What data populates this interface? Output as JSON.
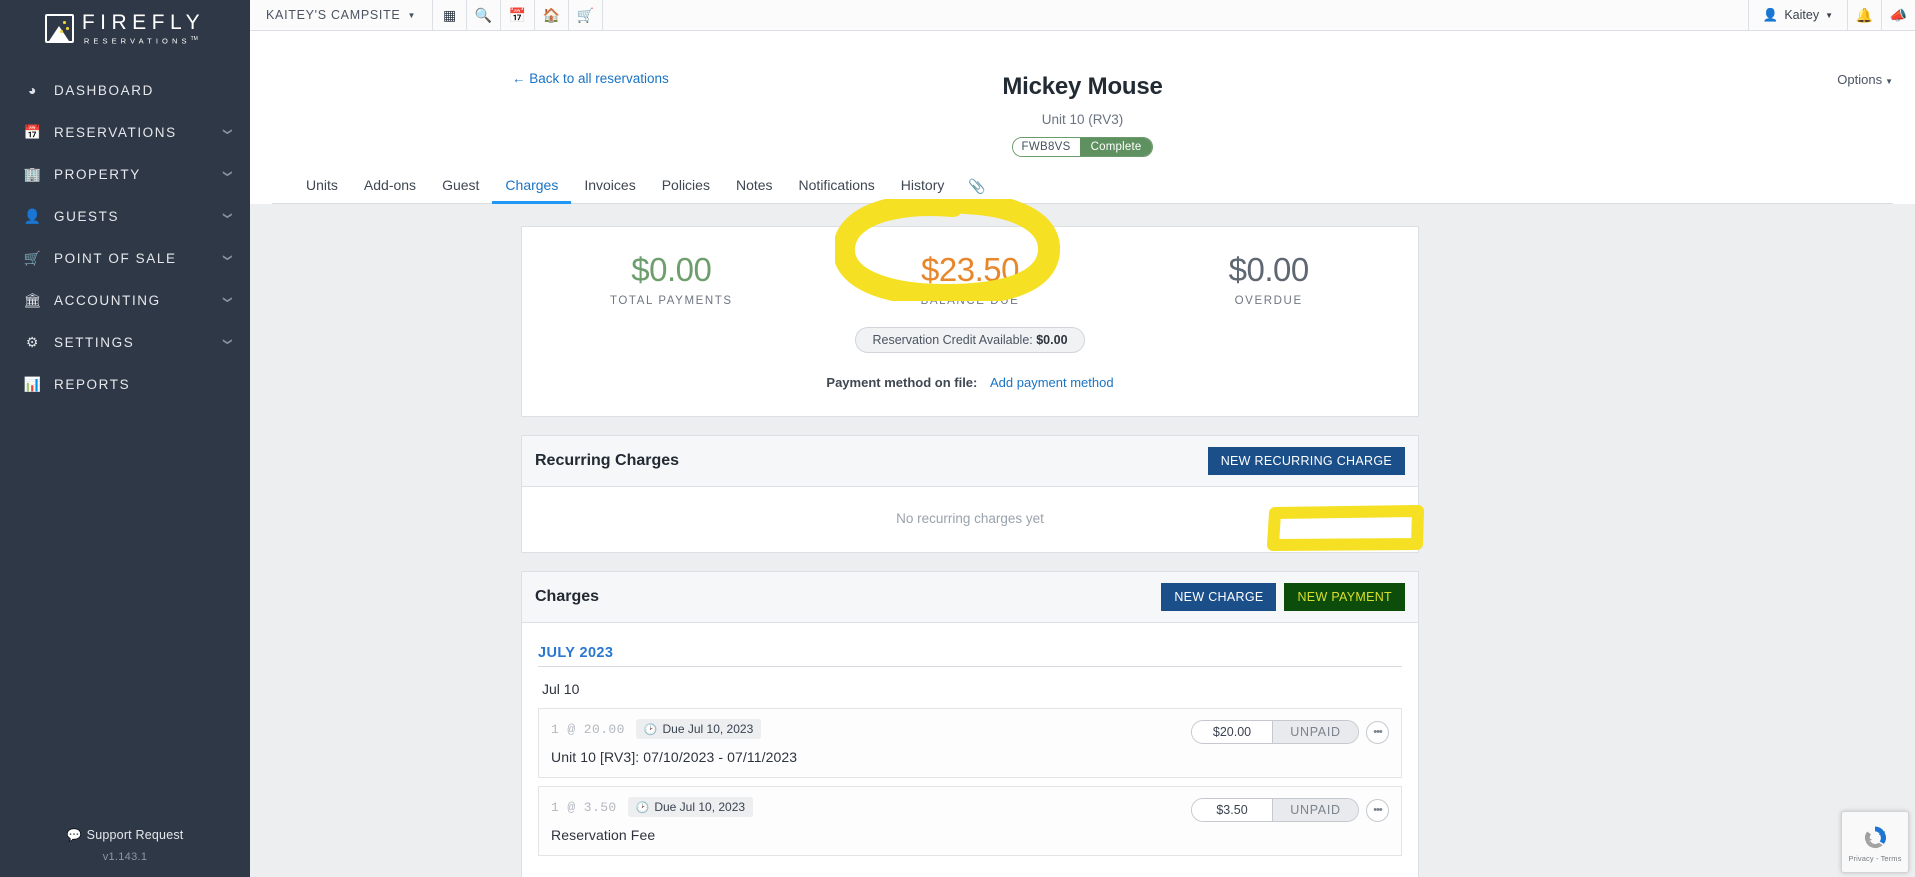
{
  "sidebar": {
    "brand": {
      "name": "FIREFLY",
      "sub": "RESERVATIONS",
      "tm": "TM",
      "logo_icon": "firefly-mountain-logo"
    },
    "items": [
      {
        "label": "DASHBOARD",
        "icon": "dashboard-gauge-icon",
        "caret": ""
      },
      {
        "label": "RESERVATIONS",
        "icon": "calendar-icon",
        "caret": "❯"
      },
      {
        "label": "PROPERTY",
        "icon": "building-icon",
        "caret": "❯"
      },
      {
        "label": "GUESTS",
        "icon": "person-icon",
        "caret": "❯"
      },
      {
        "label": "POINT OF SALE",
        "icon": "cash-register-icon",
        "caret": "❯"
      },
      {
        "label": "ACCOUNTING",
        "icon": "bank-icon",
        "caret": "❯"
      },
      {
        "label": "SETTINGS",
        "icon": "gear-icon",
        "caret": "❯"
      },
      {
        "label": "REPORTS",
        "icon": "bar-chart-icon",
        "caret": ""
      }
    ],
    "support_label": "Support Request",
    "support_icon": "speech-bubble-icon",
    "version": "v1.143.1"
  },
  "topbar": {
    "property": "KAITEY'S CAMPSITE",
    "icons": [
      "grid-apps-icon",
      "search-icon",
      "calendar-add-icon",
      "home-icon",
      "cash-register-icon"
    ],
    "user": "Kaitey",
    "user_icon": "person-icon",
    "bell_icon": "bell-icon",
    "megaphone_icon": "megaphone-icon"
  },
  "page": {
    "back_link": "← Back to all reservations",
    "options_label": "Options",
    "guest_name": "Mickey Mouse",
    "unit_line": "Unit 10 (RV3)",
    "badge_code": "FWB8VS",
    "badge_state": "Complete"
  },
  "tabs": {
    "items": [
      "Units",
      "Add-ons",
      "Guest",
      "Charges",
      "Invoices",
      "Policies",
      "Notes",
      "Notifications",
      "History"
    ],
    "active": "Charges",
    "attachment_icon": "paperclip-icon"
  },
  "summary": {
    "cells": [
      {
        "amount": "$0.00",
        "label": "TOTAL PAYMENTS",
        "color": "green"
      },
      {
        "amount": "$23.50",
        "label": "BALANCE DUE",
        "color": "orange"
      },
      {
        "amount": "$0.00",
        "label": "OVERDUE",
        "color": "grey"
      }
    ],
    "credit_label": "Reservation Credit Available:",
    "credit_value": "$0.00",
    "payment_method_label": "Payment method on file:",
    "payment_method_link": "Add payment method"
  },
  "recurring": {
    "title": "Recurring Charges",
    "new_button": "NEW RECURRING CHARGE",
    "empty_text": "No recurring charges yet"
  },
  "charges": {
    "title": "Charges",
    "new_charge_button": "NEW CHARGE",
    "new_payment_button": "NEW PAYMENT",
    "month_header": "JULY 2023",
    "day_header": "Jul 10",
    "rows": [
      {
        "qty": "1 @ 20.00",
        "due": "Due Jul 10, 2023",
        "due_icon": "clock-icon",
        "description": "Unit 10 [RV3]: 07/10/2023 - 07/11/2023",
        "amount": "$20.00",
        "status": "UNPAID",
        "menu_icon": "ellipsis-icon"
      },
      {
        "qty": "1 @ 3.50",
        "due": "Due Jul 10, 2023",
        "due_icon": "clock-icon",
        "description": "Reservation Fee",
        "amount": "$3.50",
        "status": "UNPAID",
        "menu_icon": "ellipsis-icon"
      }
    ]
  },
  "annotations": {
    "highlight_color": "#f5e024",
    "circle_target": "balance-due-amount",
    "rect_target": "new-payment-button"
  },
  "recaptcha": {
    "terms": "Privacy - Terms",
    "icon": "recaptcha-icon"
  },
  "colors": {
    "sidebar_bg": "#2f3846",
    "accent_blue": "#1a73c4",
    "button_blue": "#1b4f8a",
    "button_green": "#0c4d0c",
    "button_green_text": "#d9e02c",
    "balance_orange": "#e8862b",
    "payments_green": "#6e9e6e",
    "badge_green": "#5f9160"
  }
}
